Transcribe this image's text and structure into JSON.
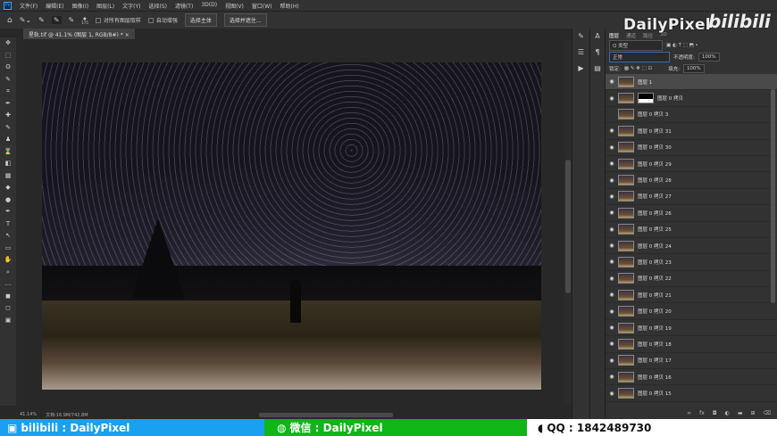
{
  "menu": [
    "文件(F)",
    "编辑(E)",
    "图像(I)",
    "图层(L)",
    "文字(Y)",
    "选择(S)",
    "滤镜(T)",
    "3D(D)",
    "视图(V)",
    "窗口(W)",
    "帮助(H)"
  ],
  "options": {
    "brush_size": "175",
    "sample_all": "对所有图层取样",
    "auto_enhance": "自动增强",
    "select_subject": "选择主体",
    "select_mask": "选择并遮住..."
  },
  "document_tab": "星轨.tif @ 41.1% (图层 1, RGB/8#) *",
  "status": {
    "zoom": "41.14%",
    "doc": "文档:16.9M/742.8M"
  },
  "panel": {
    "tabs": [
      "图层",
      "通道",
      "路径",
      "3D"
    ],
    "filter": "Q 类型",
    "blend": "正常",
    "opacity_label": "不透明度:",
    "opacity": "100%",
    "lock_label": "锁定:",
    "fill_label": "填充:",
    "fill": "100%"
  },
  "layers": [
    {
      "name": "图层 1",
      "visible": true,
      "active": true
    },
    {
      "name": "图层 0 拷贝",
      "visible": true,
      "mask": true
    },
    {
      "name": "图层 0 拷贝 3",
      "visible": false
    },
    {
      "name": "图层 0 拷贝 31",
      "visible": true
    },
    {
      "name": "图层 0 拷贝 30",
      "visible": true
    },
    {
      "name": "图层 0 拷贝 29",
      "visible": true
    },
    {
      "name": "图层 0 拷贝 28",
      "visible": true
    },
    {
      "name": "图层 0 拷贝 27",
      "visible": true
    },
    {
      "name": "图层 0 拷贝 26",
      "visible": true
    },
    {
      "name": "图层 0 拷贝 25",
      "visible": true
    },
    {
      "name": "图层 0 拷贝 24",
      "visible": true
    },
    {
      "name": "图层 0 拷贝 23",
      "visible": true
    },
    {
      "name": "图层 0 拷贝 22",
      "visible": true
    },
    {
      "name": "图层 0 拷贝 21",
      "visible": true
    },
    {
      "name": "图层 0 拷贝 20",
      "visible": true
    },
    {
      "name": "图层 0 拷贝 19",
      "visible": true
    },
    {
      "name": "图层 0 拷贝 18",
      "visible": true
    },
    {
      "name": "图层 0 拷贝 17",
      "visible": true
    },
    {
      "name": "图层 0 拷贝 16",
      "visible": true
    },
    {
      "name": "图层 0 拷贝 15",
      "visible": true
    }
  ],
  "watermark": {
    "text": "DailyPixel",
    "logo": "bilibili"
  },
  "banner": {
    "bili": "bilibili : DailyPixel",
    "wechat": "微信 : DailyPixel",
    "qq": "QQ : 1842489730"
  }
}
